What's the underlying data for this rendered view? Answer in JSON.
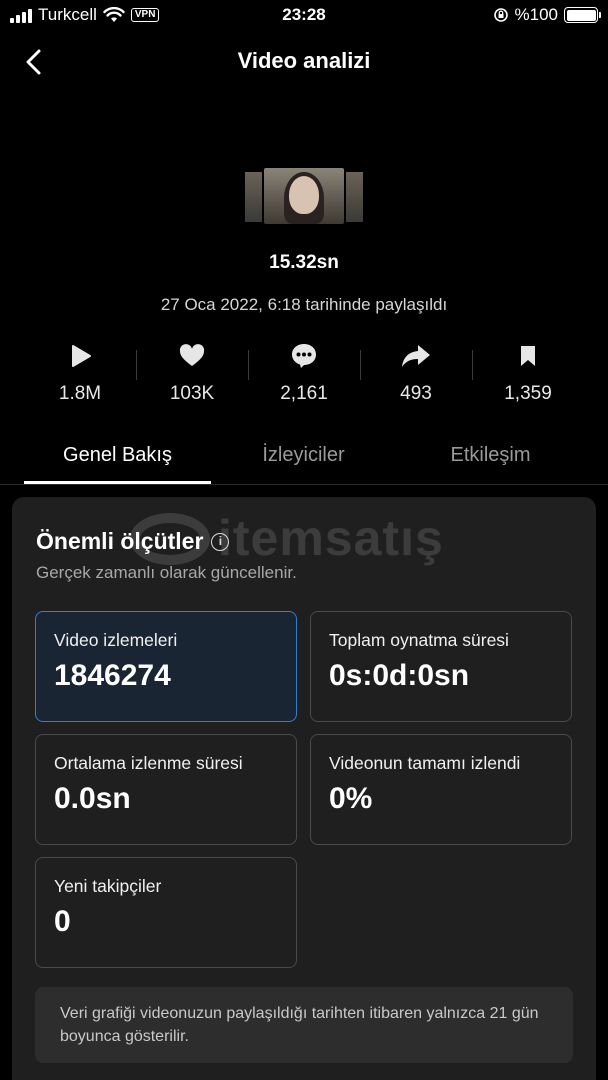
{
  "status_bar": {
    "carrier": "Turkcell",
    "vpn": "VPN",
    "time": "23:28",
    "battery_text": "%100",
    "battery_level": 1.0
  },
  "nav": {
    "back_icon": "chevron-left-icon",
    "title": "Video analizi"
  },
  "video": {
    "duration": "15.32sn",
    "posted": "27 Oca 2022, 6:18 tarihinde paylaşıldı"
  },
  "stats": [
    {
      "icon": "play-icon",
      "value": "1.8M"
    },
    {
      "icon": "heart-icon",
      "value": "103K"
    },
    {
      "icon": "comment-icon",
      "value": "2,161"
    },
    {
      "icon": "share-icon",
      "value": "493"
    },
    {
      "icon": "bookmark-icon",
      "value": "1,359"
    }
  ],
  "tabs": [
    {
      "label": "Genel Bakış",
      "active": true
    },
    {
      "label": "İzleyiciler",
      "active": false
    },
    {
      "label": "Etkileşim",
      "active": false
    }
  ],
  "metrics": {
    "title": "Önemli ölçütler",
    "subtitle": "Gerçek zamanlı olarak güncellenir.",
    "watermark": "itemsatış",
    "cards": [
      {
        "label": "Video izlemeleri",
        "value": "1846274",
        "selected": true
      },
      {
        "label": "Toplam oynatma süresi",
        "value": "0s:0d:0sn",
        "selected": false
      },
      {
        "label": "Ortalama izlenme süresi",
        "value": "0.0sn",
        "selected": false
      },
      {
        "label": "Videonun tamamı izlendi",
        "value": "0%",
        "selected": false
      },
      {
        "label": "Yeni takipçiler",
        "value": "0",
        "selected": false
      }
    ],
    "note": "Veri grafiği videonuzun paylaşıldığı tarihten itibaren yalnızca 21 gün boyunca gösterilir."
  },
  "colors": {
    "background": "#000000",
    "panel": "#1f1f1f",
    "selected_border": "#2f7fd0",
    "muted_text": "#9a9a9a"
  }
}
